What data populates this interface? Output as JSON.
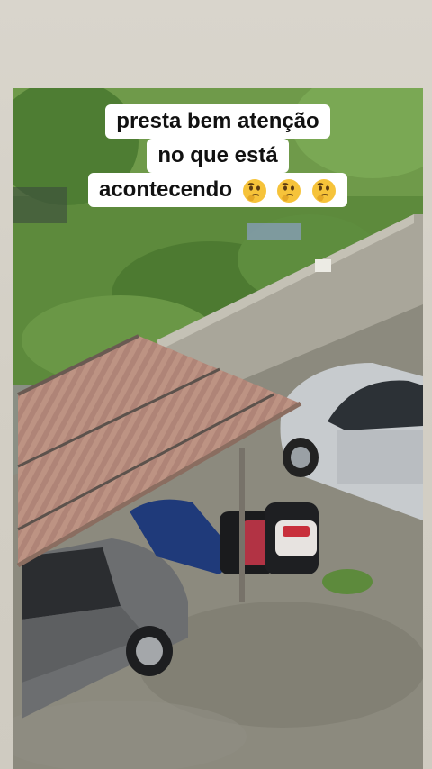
{
  "caption": {
    "lines": [
      "presta bem atenção",
      "no que está",
      "acontecendo"
    ],
    "emoji_icons": [
      "thinking-face-icon",
      "thinking-face-icon",
      "thinking-face-icon"
    ]
  },
  "colors": {
    "caption_background": "#ffffff",
    "caption_text": "#111111",
    "page_background": "#d6d2c8"
  }
}
